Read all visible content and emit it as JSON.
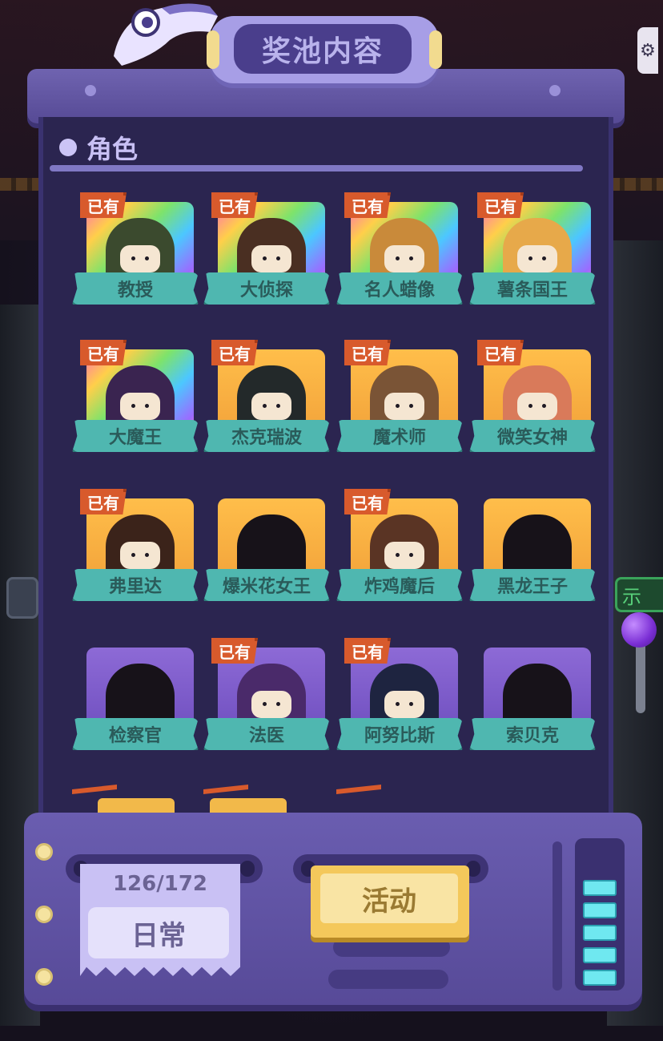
{
  "header": {
    "title": "奖池内容"
  },
  "section": {
    "title": "角色"
  },
  "owned_label": "已有",
  "characters": [
    {
      "name": "教授",
      "owned": true,
      "frame": "rainbow",
      "color": "#3b4a2e"
    },
    {
      "name": "大侦探",
      "owned": true,
      "frame": "rainbow",
      "color": "#4a2f22"
    },
    {
      "name": "名人蜡像",
      "owned": true,
      "frame": "rainbow",
      "color": "#c98a3a"
    },
    {
      "name": "薯条国王",
      "owned": true,
      "frame": "rainbow",
      "color": "#e7a94a"
    },
    {
      "name": "大魔王",
      "owned": true,
      "frame": "rainbow",
      "color": "#3a2450"
    },
    {
      "name": "杰克瑞波",
      "owned": true,
      "frame": "gold",
      "color": "#23292a"
    },
    {
      "name": "魔术师",
      "owned": true,
      "frame": "gold",
      "color": "#7a5436"
    },
    {
      "name": "微笑女神",
      "owned": true,
      "frame": "gold",
      "color": "#d97a5a"
    },
    {
      "name": "弗里达",
      "owned": true,
      "frame": "gold",
      "color": "#3b231a"
    },
    {
      "name": "爆米花女王",
      "owned": false,
      "frame": "gold",
      "color": "#171219"
    },
    {
      "name": "炸鸡魔后",
      "owned": true,
      "frame": "gold",
      "color": "#5a3424"
    },
    {
      "name": "黑龙王子",
      "owned": false,
      "frame": "gold",
      "color": "#171219"
    },
    {
      "name": "检察官",
      "owned": false,
      "frame": "purple",
      "color": "#171219"
    },
    {
      "name": "法医",
      "owned": true,
      "frame": "purple",
      "color": "#4a2a6a"
    },
    {
      "name": "阿努比斯",
      "owned": true,
      "frame": "purple",
      "color": "#1e2440"
    },
    {
      "name": "索贝克",
      "owned": false,
      "frame": "purple",
      "color": "#171219"
    }
  ],
  "console": {
    "progress": "126/172",
    "daily_tab": "日常",
    "event_tab": "活动"
  },
  "side": {
    "green_tag": "示"
  }
}
